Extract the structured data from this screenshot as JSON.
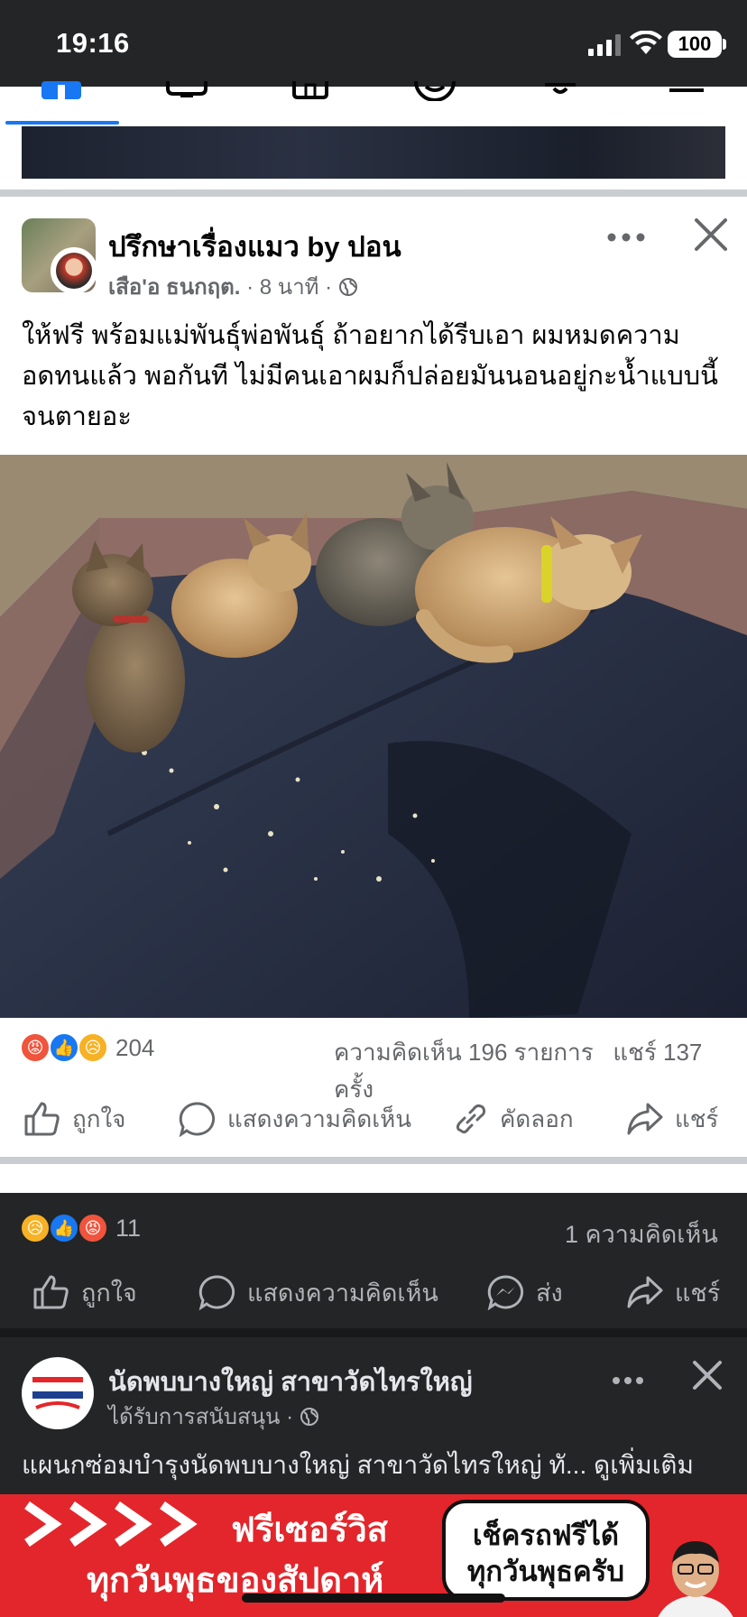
{
  "status_bar": {
    "time": "19:16",
    "battery": "100"
  },
  "post": {
    "group_name": "ปรึกษาเรื่องแมว by ปอน",
    "author": "เสือ'อ ธนกฤต.",
    "time_ago": "8 นาที",
    "sep": "·",
    "body": "ให้ฟรี พร้อมแม่พันธุ์พ่อพันธุ์ ถ้าอยากได้รีบเอา ผมหมดความอดทนแล้ว พอกันที ไม่มีคนเอาผมก็ปล่อยมันนอนอยู่กะน้ำแบบนี้จนตายอะ",
    "reaction_count": "204",
    "comment_count": "ความคิดเห็น 196 รายการ",
    "share_count": "แชร์ 137 ครั้ง",
    "actions": {
      "like": "ถูกใจ",
      "comment": "แสดงความคิดเห็น",
      "copy": "คัดลอก",
      "share": "แชร์"
    }
  },
  "next_post": {
    "reaction_count": "11",
    "comment_count": "1 ความคิดเห็น",
    "actions": {
      "like": "ถูกใจ",
      "comment": "แสดงความคิดเห็น",
      "send": "ส่ง",
      "share": "แชร์"
    }
  },
  "ad": {
    "page_name": "นัดพบบางใหญ่ สาขาวัดไทรใหญ่",
    "sponsored": "ได้รับการสนับสนุน ·",
    "text": "แผนกซ่อมบำรุงนัดพบบางใหญ่ สาขาวัดไทรใหญ่ ทั...",
    "see_more": "ดูเพิ่มเติม",
    "banner_line1": "ฟรีเซอร์วิส",
    "banner_line2": "ทุกวันพุธของสัปดาห์",
    "bubble_line1": "เช็ครถฟรีได้",
    "bubble_line2": "ทุกวันพุธครับ"
  },
  "colors": {
    "facebook_blue": "#1877f2",
    "angry": "#f0543c",
    "sad": "#f7b125",
    "banner_red": "#e3262b"
  }
}
